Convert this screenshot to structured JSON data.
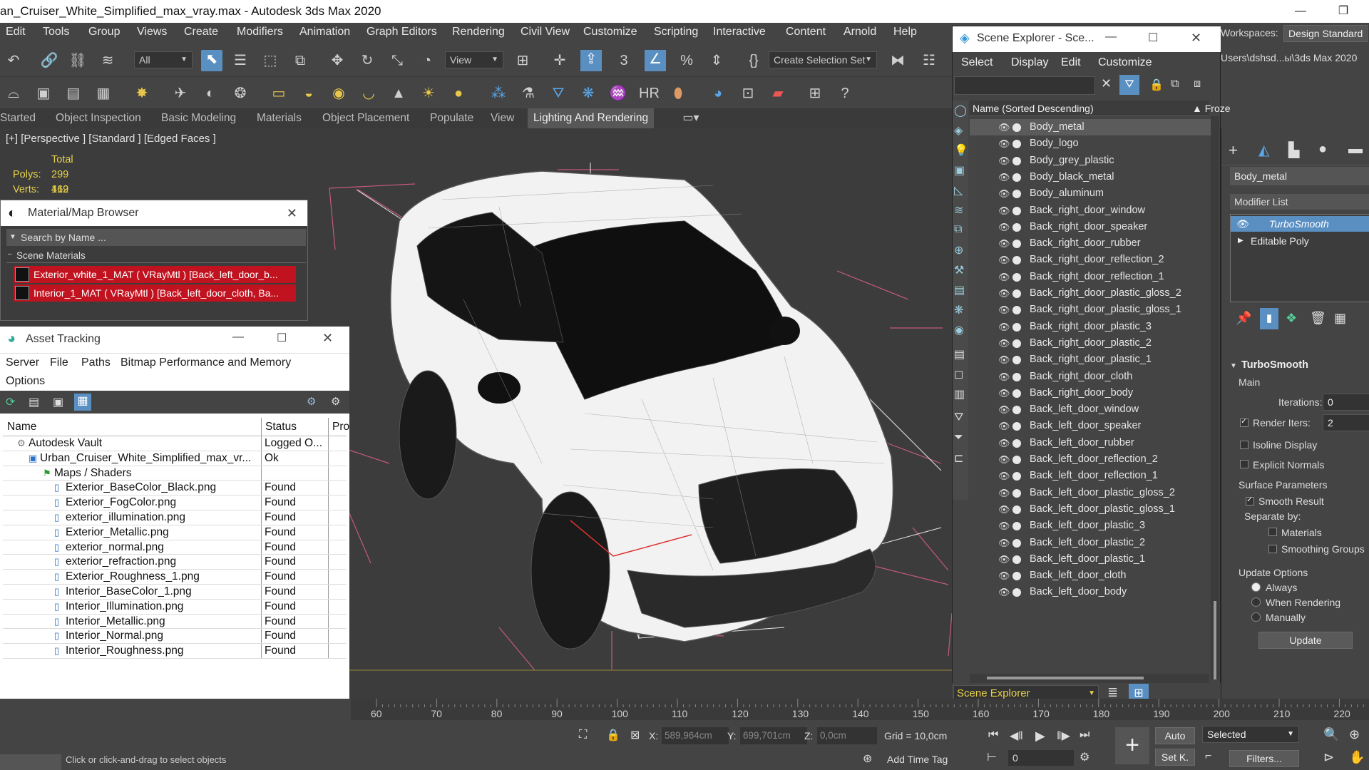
{
  "window": {
    "title": "an_Cruiser_White_Simplified_max_vray.max - Autodesk 3ds Max 2020",
    "minimize": "—",
    "restore": "❐"
  },
  "menu": [
    "Edit",
    "Tools",
    "Group",
    "Views",
    "Create",
    "Modifiers",
    "Animation",
    "Graph Editors",
    "Rendering",
    "Civil View",
    "Customize",
    "Scripting",
    "Interactive",
    "Content",
    "Arnold",
    "Help"
  ],
  "workspace": {
    "label": "Workspaces:",
    "value": "Design Standard",
    "path": "Users\\dshsd...ы\\3ds Max 2020"
  },
  "toolbar": {
    "filter": "All",
    "refcoord": "View",
    "selection_set": "Create Selection Set"
  },
  "ribbon_tabs": [
    "Started",
    "Object Inspection",
    "Basic Modeling",
    "Materials",
    "Object Placement",
    "Populate",
    "View",
    "Lighting And Rendering"
  ],
  "viewport": {
    "label": "[+] [Perspective ] [Standard ] [Edged Faces ]",
    "stats_total": "Total",
    "polys_label": "Polys:",
    "polys": "299 412",
    "verts_label": "Verts:",
    "verts": "169 231"
  },
  "material_browser": {
    "title": "Material/Map Browser",
    "search_placeholder": "Search by Name ...",
    "group": "Scene Materials",
    "items": [
      "Exterior_white_1_MAT  ( VRayMtl )  [Back_left_door_b...",
      "Interior_1_MAT  ( VRayMtl )  [Back_left_door_cloth, Ba..."
    ]
  },
  "asset_tracking": {
    "title": "Asset Tracking",
    "menu": [
      "Server",
      "File",
      "Paths",
      "Bitmap Performance and Memory"
    ],
    "menu2": "Options",
    "columns": {
      "name": "Name",
      "status": "Status",
      "pro": "Pro"
    },
    "rows": [
      {
        "name": "Autodesk Vault",
        "status": "Logged O...",
        "indent": 0
      },
      {
        "name": "Urban_Cruiser_White_Simplified_max_vr...",
        "status": "Ok",
        "indent": 1
      },
      {
        "name": "Maps / Shaders",
        "status": "",
        "indent": 2
      },
      {
        "name": "Exterior_BaseColor_Black.png",
        "status": "Found",
        "indent": 3
      },
      {
        "name": "Exterior_FogColor.png",
        "status": "Found",
        "indent": 3
      },
      {
        "name": "exterior_illumination.png",
        "status": "Found",
        "indent": 3
      },
      {
        "name": "Exterior_Metallic.png",
        "status": "Found",
        "indent": 3
      },
      {
        "name": "exterior_normal.png",
        "status": "Found",
        "indent": 3
      },
      {
        "name": "exterior_refraction.png",
        "status": "Found",
        "indent": 3
      },
      {
        "name": "Exterior_Roughness_1.png",
        "status": "Found",
        "indent": 3
      },
      {
        "name": "Interior_BaseColor_1.png",
        "status": "Found",
        "indent": 3
      },
      {
        "name": "Interior_Illumination.png",
        "status": "Found",
        "indent": 3
      },
      {
        "name": "Interior_Metallic.png",
        "status": "Found",
        "indent": 3
      },
      {
        "name": "Interior_Normal.png",
        "status": "Found",
        "indent": 3
      },
      {
        "name": "Interior_Roughness.png",
        "status": "Found",
        "indent": 3
      }
    ]
  },
  "scene_explorer": {
    "title": "Scene Explorer - Sce...",
    "menu": [
      "Select",
      "Display",
      "Edit",
      "Customize"
    ],
    "column": "Name (Sorted Descending)",
    "column2": "▲ Froze",
    "footer": "Scene Explorer",
    "items": [
      "Body_metal",
      "Body_logo",
      "Body_grey_plastic",
      "Body_black_metal",
      "Body_aluminum",
      "Back_right_door_window",
      "Back_right_door_speaker",
      "Back_right_door_rubber",
      "Back_right_door_reflection_2",
      "Back_right_door_reflection_1",
      "Back_right_door_plastic_gloss_2",
      "Back_right_door_plastic_gloss_1",
      "Back_right_door_plastic_3",
      "Back_right_door_plastic_2",
      "Back_right_door_plastic_1",
      "Back_right_door_cloth",
      "Back_right_door_body",
      "Back_left_door_window",
      "Back_left_door_speaker",
      "Back_left_door_rubber",
      "Back_left_door_reflection_2",
      "Back_left_door_reflection_1",
      "Back_left_door_plastic_gloss_2",
      "Back_left_door_plastic_gloss_1",
      "Back_left_door_plastic_3",
      "Back_left_door_plastic_2",
      "Back_left_door_plastic_1",
      "Back_left_door_cloth",
      "Back_left_door_body"
    ]
  },
  "command_panel": {
    "object_name": "Body_metal",
    "modifier_list": "Modifier List",
    "stack": [
      "TurboSmooth",
      "Editable Poly"
    ],
    "rollout": "TurboSmooth",
    "main": "Main",
    "iterations_label": "Iterations:",
    "iterations": "0",
    "render_iters_label": "Render Iters:",
    "render_iters": "2",
    "isoline": "Isoline Display",
    "explicit": "Explicit Normals",
    "surface": "Surface Parameters",
    "smooth_result": "Smooth Result",
    "separate": "Separate by:",
    "materials": "Materials",
    "smoothing_groups": "Smoothing Groups",
    "update_options": "Update Options",
    "always": "Always",
    "when_rendering": "When Rendering",
    "manually": "Manually",
    "update": "Update"
  },
  "timeline": {
    "ticks": [
      "60",
      "70",
      "80",
      "90",
      "100",
      "110",
      "120",
      "130",
      "140",
      "150",
      "160",
      "170",
      "180",
      "190",
      "200",
      "210",
      "220"
    ]
  },
  "status": {
    "hint": "Click or click-and-drag to select objects",
    "x_label": "X:",
    "x": "589,964cm",
    "y_label": "Y:",
    "y": "699,701cm",
    "z_label": "Z:",
    "z": "0,0cm",
    "grid": "Grid = 10,0cm",
    "add_time_tag": "Add Time Tag",
    "auto": "Auto",
    "selected": "Selected",
    "set_key": "Set K.",
    "filters": "Filters...",
    "frame": "0"
  }
}
